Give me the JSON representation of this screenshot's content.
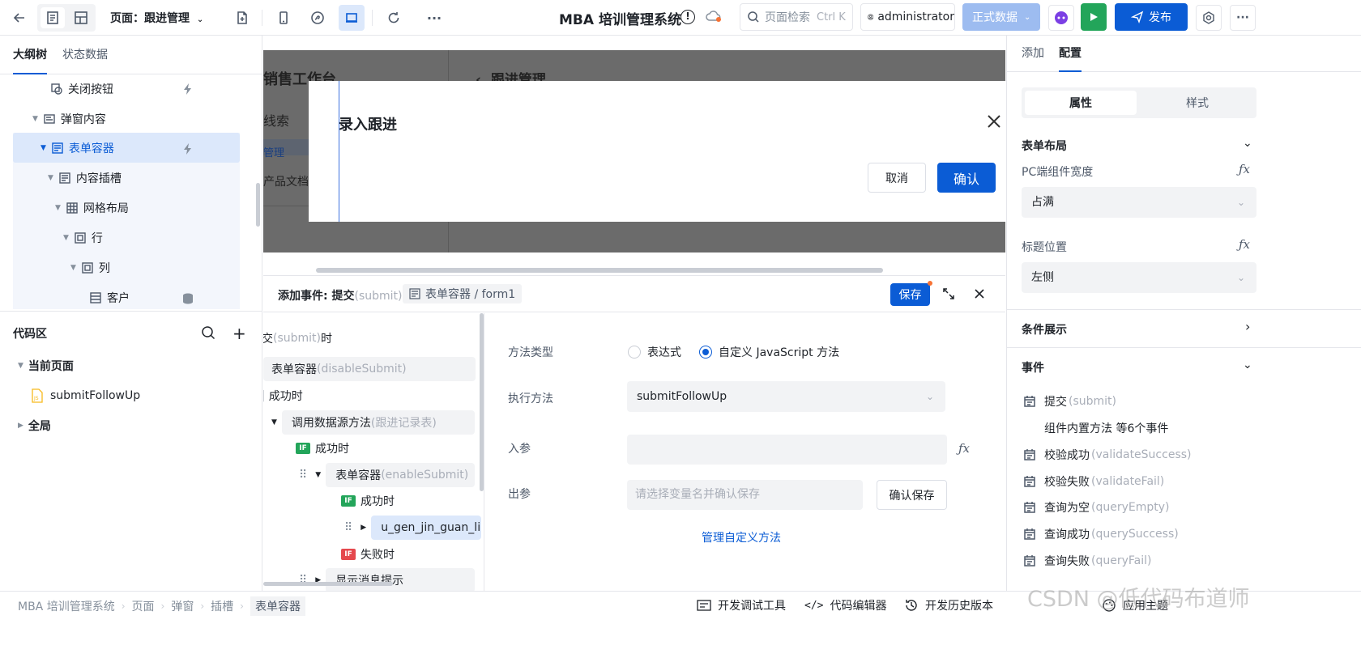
{
  "topbar": {
    "page_label": "页面：跟进管理",
    "app_title": "MBA 培训管理系统",
    "search_placeholder": "页面检索",
    "search_shortcut": "Ctrl K",
    "user": "administrator",
    "env": "正式数据",
    "publish": "发布"
  },
  "left": {
    "tabs": [
      "大纲树",
      "状态数据"
    ],
    "tree": [
      {
        "label": "关闭按钮"
      },
      {
        "label": "弹窗内容"
      },
      {
        "label": "表单容器"
      },
      {
        "label": "内容插槽"
      },
      {
        "label": "网格布局"
      },
      {
        "label": "行"
      },
      {
        "label": "列"
      },
      {
        "label": "客户"
      }
    ],
    "code_title": "代码区",
    "current_page": "当前页面",
    "file": "submitFollowUp",
    "global": "全局"
  },
  "canvas": {
    "bg_title": "销售工作台",
    "bg_header": "跟进管理",
    "bg_items": [
      "线索",
      "管理",
      "产品文档"
    ],
    "dialog_title": "录入跟进",
    "cancel": "取消",
    "confirm": "确认"
  },
  "event": {
    "title": "添加事件: 提交",
    "title_suffix": "(submit)",
    "target": "表单容器 / form1",
    "save": "保存",
    "flow": [
      {
        "text": "交",
        "muted": "(submit)",
        "tail": "时"
      },
      {
        "text": "表单容器 ",
        "muted": "(disableSubmit)"
      },
      {
        "text": "成功时"
      },
      {
        "text": "调用数据源方法 ",
        "muted": "(跟进记录表)"
      },
      {
        "text": "成功时"
      },
      {
        "text": "表单容器 ",
        "muted": "(enableSubmit)"
      },
      {
        "text": "成功时"
      },
      {
        "text": "u_gen_jin_guan_li:"
      },
      {
        "text": "失败时"
      },
      {
        "text": "显示消息提示"
      }
    ],
    "if_label": "IF",
    "method_type_label": "方法类型",
    "opt_expression": "表达式",
    "opt_custom": "自定义 JavaScript 方法",
    "exec_label": "执行方法",
    "exec_value": "submitFollowUp",
    "input_label": "入参",
    "output_label": "出参",
    "output_placeholder": "请选择变量名并确认保存",
    "confirm_save": "确认保存",
    "manage_link": "管理自定义方法"
  },
  "right": {
    "tabs": [
      "添加",
      "配置"
    ],
    "segment": [
      "属性",
      "样式"
    ],
    "form_layout": "表单布局",
    "pc_width_label": "PC端组件宽度",
    "pc_width_value": "占满",
    "title_pos_label": "标题位置",
    "title_pos_value": "左侧",
    "condition": "条件展示",
    "events": "事件",
    "event_list": [
      {
        "name": "提交",
        "code": "(submit)"
      },
      {
        "name": "组件内置方法 等6个事件",
        "code": ""
      },
      {
        "name": "校验成功",
        "code": "(validateSuccess)"
      },
      {
        "name": "校验失败",
        "code": "(validateFail)"
      },
      {
        "name": "查询为空",
        "code": "(queryEmpty)"
      },
      {
        "name": "查询成功",
        "code": "(querySuccess)"
      },
      {
        "name": "查询失败",
        "code": "(queryFail)"
      }
    ]
  },
  "statusbar": {
    "crumbs": [
      "MBA 培训管理系统",
      "页面",
      "弹窗",
      "插槽",
      "表单容器"
    ],
    "tools": [
      "开发调试工具",
      "代码编辑器",
      "开发历史版本",
      "应用主题"
    ]
  },
  "watermark": "CSDN @低代码布道师",
  "colors": {
    "primary": "#0b5cd5",
    "env_button": "#9dbcf0",
    "run": "#23a55a",
    "selected_row": "#dce8fb"
  }
}
